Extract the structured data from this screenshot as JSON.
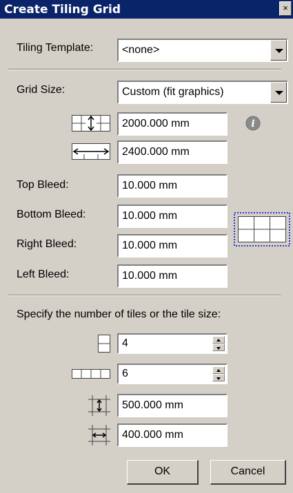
{
  "window": {
    "title": "Create Tiling Grid",
    "close_glyph": "×"
  },
  "template": {
    "label": "Tiling Template:",
    "value": "<none>"
  },
  "grid_size": {
    "label": "Grid Size:",
    "value": "Custom (fit graphics)",
    "height": "2000.000 mm",
    "width": "2400.000 mm",
    "info_glyph": "i"
  },
  "bleed": {
    "top_label": "Top Bleed:",
    "top_value": "10.000 mm",
    "bottom_label": "Bottom Bleed:",
    "bottom_value": "10.000 mm",
    "right_label": "Right Bleed:",
    "right_value": "10.000 mm",
    "left_label": "Left Bleed:",
    "left_value": "10.000 mm"
  },
  "tiles": {
    "instruction": "Specify the number of tiles or the tile size:",
    "rows": "4",
    "columns": "6",
    "tile_height": "500.000 mm",
    "tile_width": "400.000 mm"
  },
  "buttons": {
    "ok": "OK",
    "cancel": "Cancel"
  },
  "icons": {
    "grid_height": "grid-height-icon",
    "grid_width": "grid-width-icon",
    "info": "info-icon",
    "bleed_preview": "bleed-preview-icon",
    "rows": "tile-rows-icon",
    "columns": "tile-columns-icon",
    "tile_height": "tile-height-icon",
    "tile_width": "tile-width-icon"
  },
  "colors": {
    "titlebar": "#0a246a",
    "dialog": "#d4d0c8",
    "preview_border": "#3333cc"
  }
}
